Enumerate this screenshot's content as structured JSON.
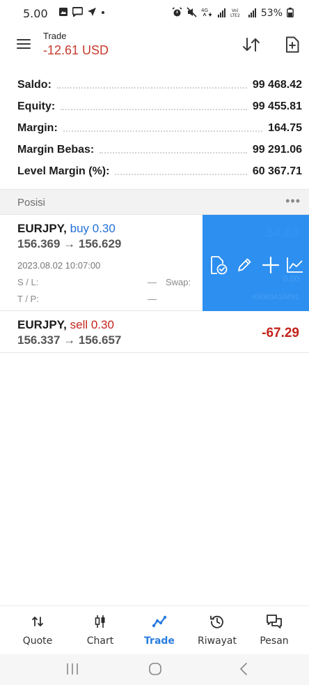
{
  "status_bar": {
    "time": "5.00",
    "battery": "53%",
    "icons_left": [
      "image-icon",
      "chat-bubble-icon",
      "send-icon",
      "dot-icon"
    ],
    "icons_right": [
      "alarm-icon",
      "mute-icon",
      "4g-icon",
      "signal-icon",
      "volte-icon",
      "signal-icon",
      "battery-icon"
    ]
  },
  "header": {
    "title": "Trade",
    "profit": "-12.61 USD",
    "profit_color": "#c73a2c"
  },
  "summary": [
    {
      "label": "Saldo:",
      "value": "99 468.42"
    },
    {
      "label": "Equity:",
      "value": "99 455.81"
    },
    {
      "label": "Margin:",
      "value": "164.75"
    },
    {
      "label": "Margin Bebas:",
      "value": "99 291.06"
    },
    {
      "label": "Level Margin (%):",
      "value": "60 367.71"
    }
  ],
  "positions_header": {
    "title": "Posisi",
    "more": "•••"
  },
  "positions": [
    {
      "symbol": "EURJPY,",
      "side": "buy 0.30",
      "prices": "156.369 → 156.629",
      "datetime": "2023.08.02 10:07:00",
      "sl_label": "S / L:",
      "sl_value": "—",
      "tp_label": "T / P:",
      "tp_value": "—",
      "swap_label": "Swap:",
      "swap_value": "0.00",
      "profit": "54.68",
      "ticket": "#5060410491"
    },
    {
      "symbol": "EURJPY,",
      "side": "sell 0.30",
      "prices": "156.337 → 156.657",
      "profit": "-67.29"
    }
  ],
  "swipe_actions": [
    {
      "name": "close-position-icon"
    },
    {
      "name": "edit-icon"
    },
    {
      "name": "add-icon"
    },
    {
      "name": "chart-icon"
    }
  ],
  "colors": {
    "accent": "#2a7de0",
    "swipe_bg": "#2d8ff0",
    "buy": "#2370d8",
    "sell": "#c4231c"
  },
  "bottom_nav": [
    {
      "label": "Quote",
      "icon": "quote-arrows-icon",
      "active": false
    },
    {
      "label": "Chart",
      "icon": "candlestick-icon",
      "active": false
    },
    {
      "label": "Trade",
      "icon": "trade-line-icon",
      "active": true
    },
    {
      "label": "Riwayat",
      "icon": "history-icon",
      "active": false
    },
    {
      "label": "Pesan",
      "icon": "messages-icon",
      "active": false
    }
  ],
  "system_nav": [
    "recents-icon",
    "home-icon",
    "back-icon"
  ]
}
